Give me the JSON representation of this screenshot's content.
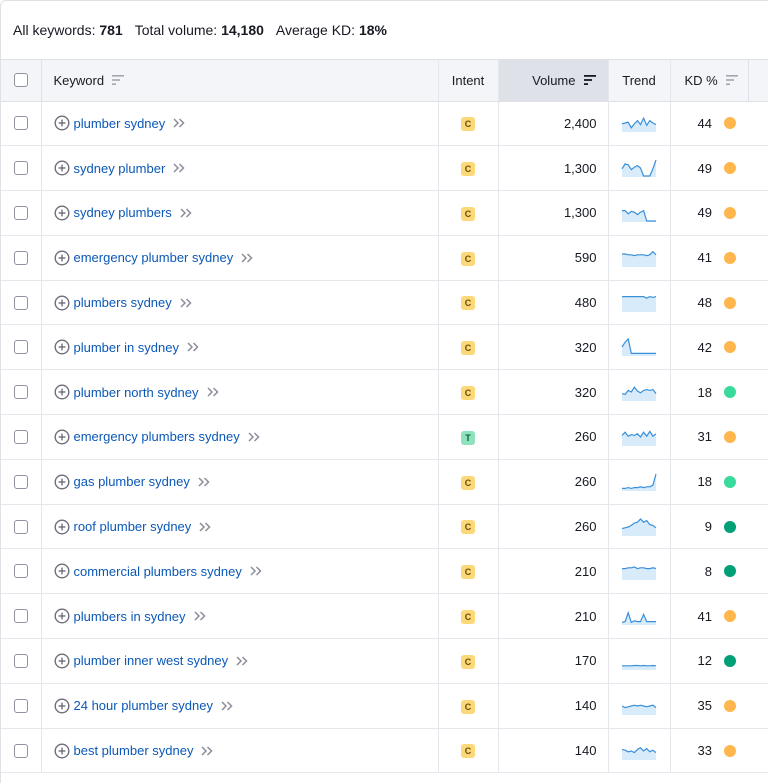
{
  "summary": {
    "all_keywords_label": "All keywords:",
    "all_keywords_value": "781",
    "total_volume_label": "Total volume:",
    "total_volume_value": "14,180",
    "avg_kd_label": "Average KD:",
    "avg_kd_value": "18%"
  },
  "columns": {
    "keyword": "Keyword",
    "intent": "Intent",
    "volume": "Volume",
    "trend": "Trend",
    "kd": "KD %"
  },
  "colors": {
    "link": "#0a58b8",
    "intent_commercial_bg": "#fbd87a",
    "intent_commercial_fg": "#6b4e00",
    "intent_transactional_bg": "#8ee3bd",
    "intent_transactional_fg": "#0b5c3b",
    "kd_easy": "#3ad99c",
    "kd_very_easy": "#009f76",
    "kd_possible": "#ffb64c",
    "trend_stroke": "#3a8fd9",
    "trend_fill": "#d7ebfb"
  },
  "icons": {
    "add": "plus-circle-icon",
    "more": "double-chevron-right-icon",
    "sort": "sort-lines-icon"
  },
  "rows": [
    {
      "keyword": "plumber sydney",
      "intent": "C",
      "volume": "2,400",
      "kd": "44",
      "kd_level": "possible",
      "trend": [
        0.55,
        0.5,
        0.45,
        0.8,
        0.55,
        0.35,
        0.6,
        0.2,
        0.65,
        0.35,
        0.5,
        0.6
      ]
    },
    {
      "keyword": "sydney plumber",
      "intent": "C",
      "volume": "1,300",
      "kd": "49",
      "kd_level": "possible",
      "trend": [
        0.55,
        0.25,
        0.3,
        0.6,
        0.45,
        0.35,
        0.5,
        1.0,
        1.0,
        1.0,
        0.55,
        0.0
      ]
    },
    {
      "keyword": "sydney plumbers",
      "intent": "C",
      "volume": "1,300",
      "kd": "49",
      "kd_level": "possible",
      "trend": [
        0.35,
        0.35,
        0.55,
        0.4,
        0.45,
        0.6,
        0.45,
        0.35,
        1.0,
        1.0,
        1.0,
        1.0
      ]
    },
    {
      "keyword": "emergency plumber sydney",
      "intent": "C",
      "volume": "590",
      "kd": "41",
      "kd_level": "possible",
      "trend": [
        0.25,
        0.25,
        0.3,
        0.3,
        0.35,
        0.3,
        0.3,
        0.3,
        0.35,
        0.3,
        0.1,
        0.3
      ]
    },
    {
      "keyword": "plumbers sydney",
      "intent": "C",
      "volume": "480",
      "kd": "48",
      "kd_level": "possible",
      "trend": [
        0.1,
        0.1,
        0.1,
        0.1,
        0.1,
        0.1,
        0.1,
        0.1,
        0.2,
        0.1,
        0.15,
        0.1
      ]
    },
    {
      "keyword": "plumber in sydney",
      "intent": "C",
      "volume": "320",
      "kd": "42",
      "kd_level": "possible",
      "trend": [
        0.5,
        0.2,
        0.0,
        0.9,
        0.9,
        0.9,
        0.9,
        0.9,
        0.9,
        0.9,
        0.9,
        0.9
      ]
    },
    {
      "keyword": "plumber north sydney",
      "intent": "C",
      "volume": "320",
      "kd": "18",
      "kd_level": "easy",
      "trend": [
        0.6,
        0.65,
        0.4,
        0.5,
        0.2,
        0.45,
        0.55,
        0.4,
        0.35,
        0.4,
        0.35,
        0.6
      ]
    },
    {
      "keyword": "emergency plumbers sydney",
      "intent": "T",
      "volume": "260",
      "kd": "31",
      "kd_level": "possible",
      "trend": [
        0.4,
        0.2,
        0.45,
        0.35,
        0.4,
        0.3,
        0.5,
        0.2,
        0.45,
        0.15,
        0.45,
        0.3
      ]
    },
    {
      "keyword": "gas plumber sydney",
      "intent": "C",
      "volume": "260",
      "kd": "18",
      "kd_level": "easy",
      "trend": [
        0.9,
        0.9,
        0.85,
        0.9,
        0.85,
        0.85,
        0.8,
        0.85,
        0.8,
        0.8,
        0.7,
        0.0
      ]
    },
    {
      "keyword": "roof plumber sydney",
      "intent": "C",
      "volume": "260",
      "kd": "9",
      "kd_level": "very_easy",
      "trend": [
        0.6,
        0.55,
        0.5,
        0.4,
        0.25,
        0.2,
        0.0,
        0.2,
        0.1,
        0.35,
        0.4,
        0.55
      ]
    },
    {
      "keyword": "commercial plumbers sydney",
      "intent": "C",
      "volume": "210",
      "kd": "8",
      "kd_level": "very_easy",
      "trend": [
        0.35,
        0.35,
        0.3,
        0.3,
        0.25,
        0.35,
        0.3,
        0.3,
        0.35,
        0.35,
        0.3,
        0.35
      ]
    },
    {
      "keyword": "plumbers in sydney",
      "intent": "C",
      "volume": "210",
      "kd": "41",
      "kd_level": "possible",
      "trend": [
        0.9,
        0.85,
        0.3,
        0.9,
        0.8,
        0.85,
        0.85,
        0.4,
        0.85,
        0.85,
        0.85,
        0.85
      ]
    },
    {
      "keyword": "plumber inner west sydney",
      "intent": "C",
      "volume": "170",
      "kd": "12",
      "kd_level": "very_easy",
      "trend": [
        0.8,
        0.8,
        0.8,
        0.8,
        0.78,
        0.78,
        0.8,
        0.78,
        0.8,
        0.8,
        0.78,
        0.8
      ]
    },
    {
      "keyword": "24 hour plumber sydney",
      "intent": "C",
      "volume": "140",
      "kd": "35",
      "kd_level": "possible",
      "trend": [
        0.5,
        0.6,
        0.55,
        0.5,
        0.45,
        0.5,
        0.45,
        0.5,
        0.55,
        0.5,
        0.45,
        0.6
      ]
    },
    {
      "keyword": "best plumber sydney",
      "intent": "C",
      "volume": "140",
      "kd": "33",
      "kd_level": "possible",
      "trend": [
        0.4,
        0.45,
        0.55,
        0.5,
        0.6,
        0.4,
        0.3,
        0.5,
        0.35,
        0.55,
        0.45,
        0.6
      ]
    }
  ]
}
